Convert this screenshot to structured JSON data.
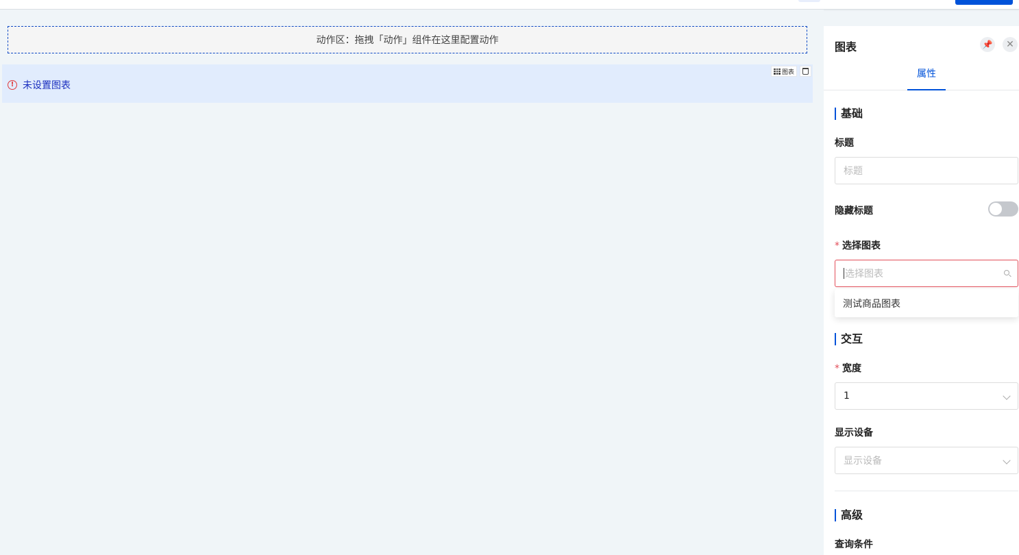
{
  "action_zone": {
    "text": "动作区：拖拽「动作」组件在这里配置动作"
  },
  "chart_block": {
    "warning": "未设置图表",
    "toolbar_chart_label": "图表"
  },
  "panel": {
    "title": "图表",
    "tabs": [
      {
        "label": "属性",
        "active": true
      }
    ],
    "sections": {
      "basic": "基础",
      "interaction": "交互",
      "advanced": "高级"
    },
    "fields": {
      "title_label": "标题",
      "title_placeholder": "标题",
      "hide_title_label": "隐藏标题",
      "hide_title_on": false,
      "select_chart_label": "选择图表",
      "select_chart_placeholder": "选择图表",
      "select_chart_options": [
        "测试商品图表"
      ],
      "width_label": "宽度",
      "width_value": "1",
      "device_label": "显示设备",
      "device_placeholder": "显示设备",
      "query_label": "查询条件"
    },
    "required_mark": "*"
  },
  "colors": {
    "accent": "#0052d9",
    "error": "#e34d59",
    "selected_block_bg": "#e1ecfd"
  }
}
